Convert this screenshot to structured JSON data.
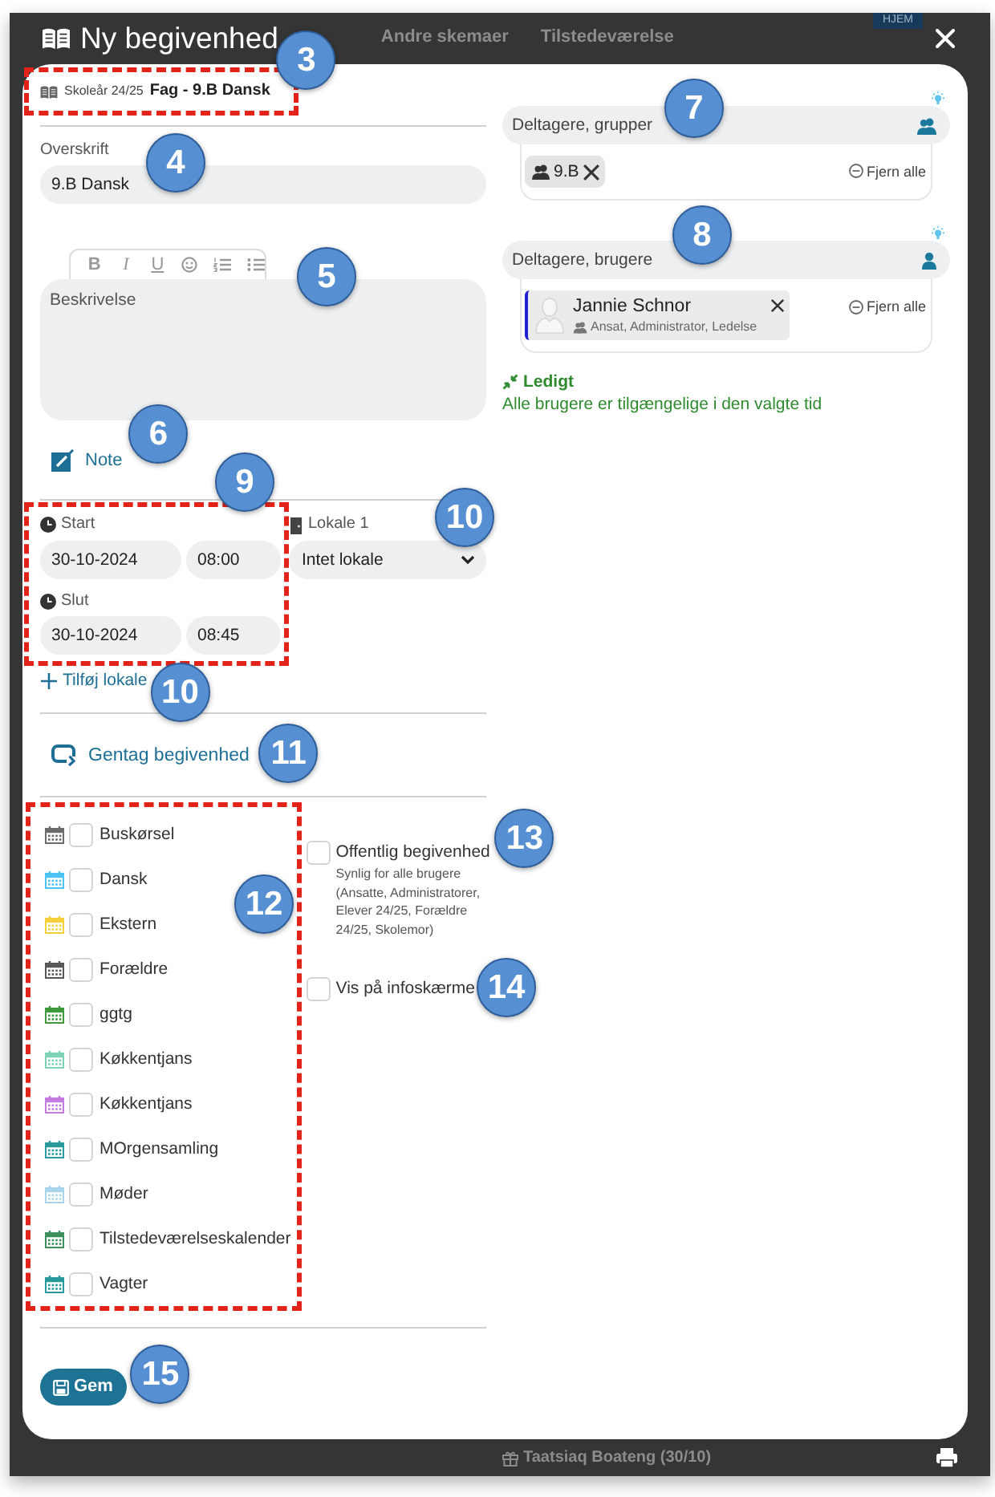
{
  "backdrop": {
    "tabs": [
      "Andre skemaer",
      "Tilstedeværelse"
    ],
    "home_button": "HJEM",
    "list_entry": "Taatsiaq Boateng (30/10)"
  },
  "dialog": {
    "title": "Ny begivenhed"
  },
  "breadcrumb": {
    "school_year": "Skoleår 24/25",
    "subject": "Fag - 9.B Dansk",
    "highlighted": true,
    "callout": "3"
  },
  "heading_field": {
    "label": "Overskrift",
    "value": "9.B Dansk",
    "callout": "4"
  },
  "description": {
    "toolbar": [
      "B",
      "I",
      "U"
    ],
    "placeholder": "Beskrivelse",
    "callout": "5"
  },
  "note_link": {
    "label": "Note",
    "callout": "6"
  },
  "time": {
    "highlighted": true,
    "callout": "9",
    "start": {
      "label": "Start",
      "date": "30-10-2024",
      "time": "08:00"
    },
    "end": {
      "label": "Slut",
      "date": "30-10-2024",
      "time": "08:45"
    }
  },
  "room": {
    "label": "Lokale 1",
    "value": "Intet lokale",
    "callout": "10"
  },
  "add_room": {
    "label": "Tilføj lokale",
    "callout": "10"
  },
  "repeat_link": {
    "label": "Gentag begivenhed",
    "callout": "11"
  },
  "calendars": {
    "highlighted": true,
    "callout": "12",
    "items": [
      {
        "name": "Buskørsel",
        "color": "#6b6b6b",
        "checked": false
      },
      {
        "name": "Dansk",
        "color": "#4cc3f5",
        "checked": false
      },
      {
        "name": "Ekstern",
        "color": "#f5cf3c",
        "checked": false
      },
      {
        "name": "Forældre",
        "color": "#575757",
        "checked": false
      },
      {
        "name": "ggtg",
        "color": "#3c9a3c",
        "checked": false
      },
      {
        "name": "Køkkentjans",
        "color": "#7dd3b5",
        "checked": false
      },
      {
        "name": "Køkkentjans",
        "color": "#c47be0",
        "checked": false
      },
      {
        "name": "MOrgensamling",
        "color": "#2a9a9a",
        "checked": false
      },
      {
        "name": "Møder",
        "color": "#a9d5ea",
        "checked": false
      },
      {
        "name": "Tilstedeværelseskalender",
        "color": "#3a8f5a",
        "checked": false
      },
      {
        "name": "Vagter",
        "color": "#27999b",
        "checked": false
      }
    ]
  },
  "public_event": {
    "label": "Offentlig begivenhed",
    "hint": "Synlig for alle brugere (Ansatte, Administratorer, Elever 24/25, Forældre 24/25, Skolemor)",
    "checked": false,
    "callout": "13"
  },
  "info_screen": {
    "label": "Vis på infoskærme",
    "checked": false,
    "callout": "14"
  },
  "save_button": {
    "label": "Gem",
    "callout": "15"
  },
  "groups": {
    "placeholder": "Deltagere, grupper",
    "callout": "7",
    "chips": [
      {
        "label": "9.B"
      }
    ],
    "remove_all": "Fjern alle"
  },
  "users": {
    "placeholder": "Deltagere, brugere",
    "callout": "8",
    "chips": [
      {
        "name": "Jannie Schnor",
        "roles": "Ansat, Administrator, Ledelse"
      }
    ],
    "remove_all": "Fjern alle"
  },
  "availability": {
    "status": "Ledigt",
    "message": "Alle brugere er tilgængelige i den valgte tid"
  }
}
